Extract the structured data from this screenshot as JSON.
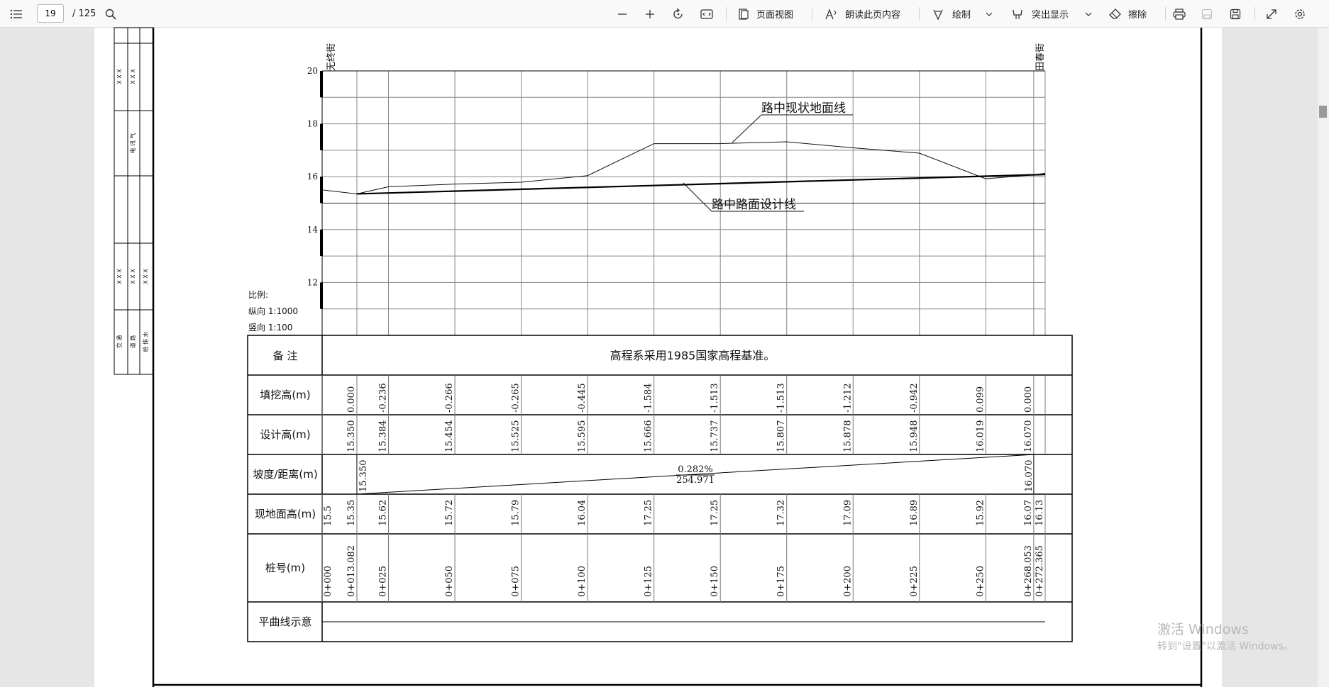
{
  "toolbar": {
    "page_current": "19",
    "page_total": "/ 125",
    "page_view_label": "页面视图",
    "read_aloud_label": "朗读此页内容",
    "draw_label": "绘制",
    "highlight_label": "突出显示",
    "erase_label": "擦除",
    "icons": [
      "list-icon",
      "search-icon",
      "zoom-out-icon",
      "zoom-in-icon",
      "rotate-icon",
      "fit-width-icon",
      "page-view-icon",
      "read-aloud-icon",
      "draw-icon",
      "chevron-down-icon",
      "highlight-icon",
      "erase-icon",
      "print-icon",
      "save-icon",
      "save-as-icon",
      "fullscreen-icon",
      "gear-icon"
    ]
  },
  "drawing": {
    "left_block": {
      "group1": "X X X",
      "group2": "X X X",
      "cell_a": "电 讯 气",
      "cell_b": "X X X",
      "cell_c": "X X X",
      "cell_d": "X X X",
      "cell_e": "交 通",
      "cell_f": "道 路",
      "cell_g": "给 排 水"
    },
    "street_left": "无终街",
    "street_right": "田春街",
    "y_ticks": [
      "20",
      "18",
      "16",
      "14",
      "12"
    ],
    "scale": {
      "title": "比例:",
      "h": "纵向 1:1000",
      "v": "竖向 1:100"
    },
    "label_ground": "路中现状地面线",
    "label_design": "路中路面设计线",
    "note_label": "备    注",
    "note_text": "高程系采用1985国家高程基准。",
    "row_labels": [
      "填挖高(m)",
      "设计高(m)",
      "坡度/距离(m)",
      "现地面高(m)",
      "桩号(m)",
      "平曲线示意"
    ],
    "fill_values": [
      "0.000",
      "-0.236",
      "-0.266",
      "-0.265",
      "-0.445",
      "-1.584",
      "-1.513",
      "-1.513",
      "-1.212",
      "-0.942",
      "0.099",
      "0.000"
    ],
    "design_values": [
      "15.350",
      "15.384",
      "15.454",
      "15.525",
      "15.595",
      "15.666",
      "15.737",
      "15.807",
      "15.878",
      "15.948",
      "16.019",
      "16.070"
    ],
    "slope": {
      "start": "15.350",
      "end": "16.070",
      "grade": "0.282%",
      "length": "254.971"
    },
    "ground_values": [
      "15.5",
      "15.35",
      "15.62",
      "15.72",
      "15.79",
      "16.04",
      "17.25",
      "17.25",
      "17.32",
      "17.09",
      "16.89",
      "15.92",
      "16.07",
      "16.13"
    ],
    "stations": [
      "0+000",
      "0+013.082",
      "0+025",
      "0+050",
      "0+075",
      "0+100",
      "0+125",
      "0+150",
      "0+175",
      "0+200",
      "0+225",
      "0+250",
      "0+268.053",
      "0+272.365"
    ]
  },
  "watermark": {
    "line1": "激活 Windows",
    "line2": "转到\"设置\"以激活 Windows。"
  }
}
